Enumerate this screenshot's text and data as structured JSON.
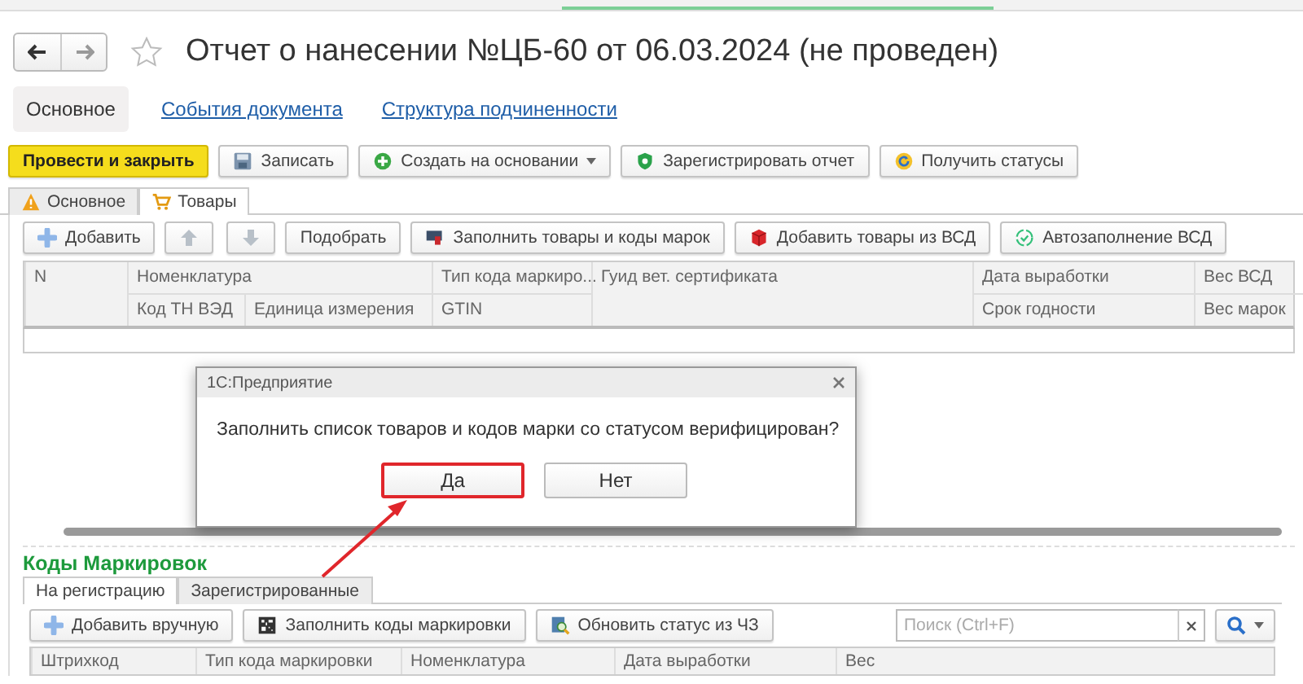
{
  "window": {
    "title": "Отчет о нанесении №ЦБ-60 от 06.03.2024 (не проведен)",
    "favorite": false
  },
  "nav_links": [
    {
      "label": "Основное",
      "selected": true
    },
    {
      "label": "События документа",
      "selected": false
    },
    {
      "label": "Структура подчиненности",
      "selected": false
    }
  ],
  "command_bar": [
    {
      "label": "Провести и закрыть",
      "kind": "primary"
    },
    {
      "label": "Записать",
      "kind": "save"
    },
    {
      "label": "Создать на основании",
      "kind": "create"
    },
    {
      "label": "Зарегистрировать отчет",
      "kind": "register"
    },
    {
      "label": "Получить статусы",
      "kind": "refresh"
    }
  ],
  "tabs": [
    {
      "label": "Основное",
      "kind": "warning",
      "selected": false
    },
    {
      "label": "Товары",
      "kind": "cart",
      "selected": true
    }
  ],
  "goods_toolbar": [
    {
      "label": "Добавить",
      "kind": "add"
    },
    {
      "kind": "move"
    },
    {
      "label": "Подобрать",
      "kind": "plain"
    },
    {
      "label": "Заполнить товары и коды марок",
      "kind": "fill"
    },
    {
      "label": "Добавить товары из ВСД",
      "kind": "cube"
    },
    {
      "label": "Автозаполнение ВСД",
      "kind": "auto"
    }
  ],
  "goods_table": {
    "columns": [
      {
        "label": "N"
      },
      {
        "label": "Номенклатура",
        "sub": [
          "Код ТН ВЭД",
          "Единица измерения"
        ]
      },
      {
        "label": "Тип кода маркиро...",
        "sub": [
          "GTIN"
        ]
      },
      {
        "label": "Гуид вет. сертификата"
      },
      {
        "label": "Дата выработки",
        "sub": [
          "Срок годности"
        ]
      },
      {
        "label": "Вес ВСД",
        "sub": [
          "Вес марок"
        ]
      }
    ]
  },
  "dialog": {
    "title": "1С:Предприятие",
    "message": "Заполнить список товаров и кодов марки со статусом верифицирован?",
    "buttons": [
      {
        "label": "Да",
        "highlighted": true
      },
      {
        "label": "Нет",
        "highlighted": false
      }
    ]
  },
  "marking_section": {
    "title": "Коды Маркировок",
    "tabs": [
      {
        "label": "На регистрацию",
        "selected": true
      },
      {
        "label": "Зарегистрированные",
        "selected": false
      }
    ],
    "toolbar": [
      {
        "label": "Добавить вручную",
        "kind": "add"
      },
      {
        "label": "Заполнить коды маркировки",
        "kind": "qr"
      },
      {
        "label": "Обновить статус из ЧЗ",
        "kind": "update"
      }
    ],
    "search": {
      "placeholder": "Поиск (Ctrl+F)"
    },
    "columns": [
      "Штрихкод",
      "Тип кода маркировки",
      "Номенклатура",
      "Дата выработки",
      "Вес"
    ]
  }
}
